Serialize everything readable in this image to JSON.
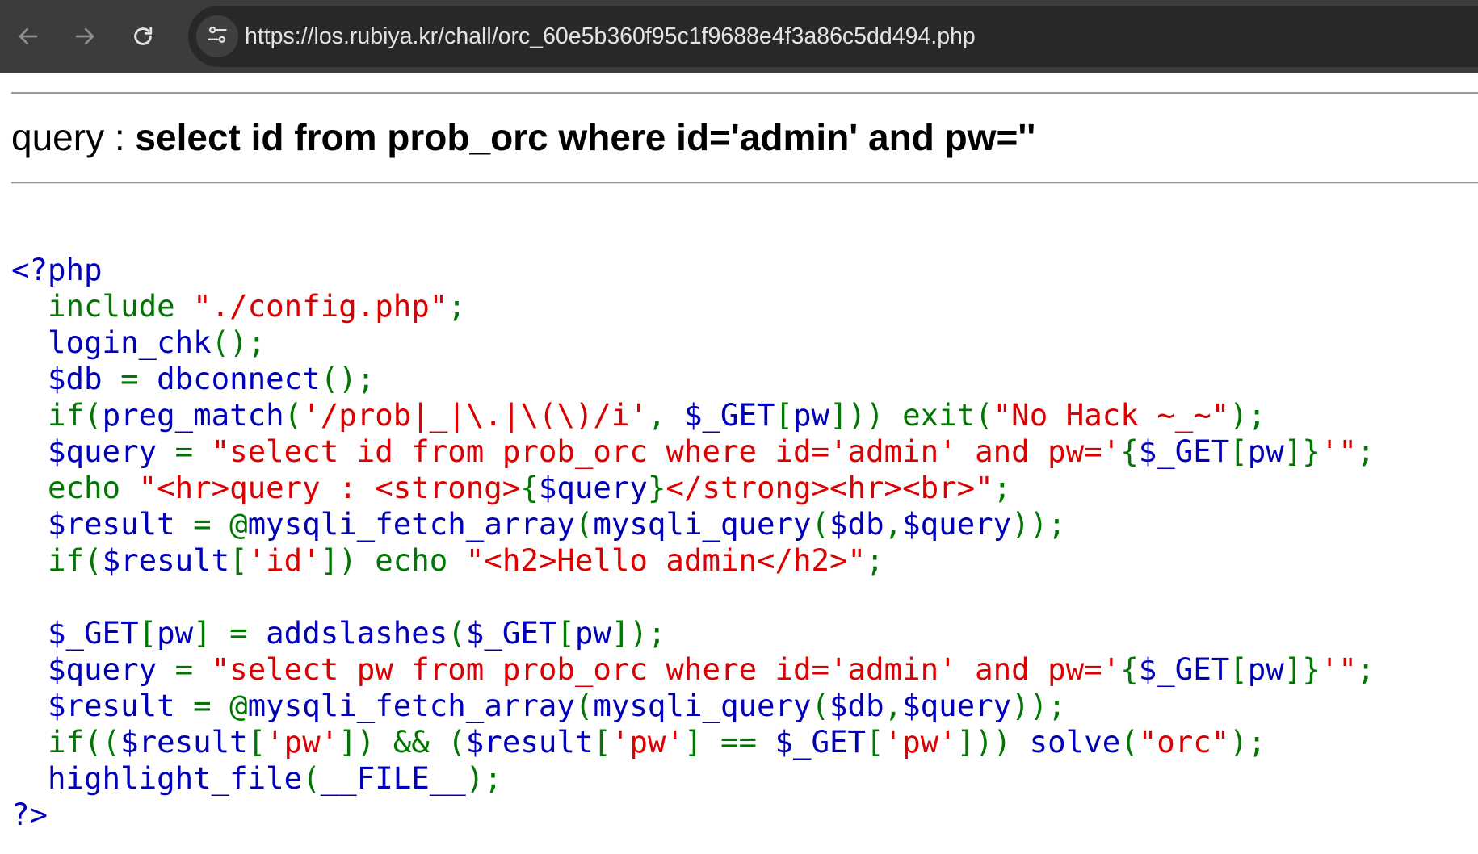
{
  "browser": {
    "url": "https://los.rubiya.kr/chall/orc_60e5b360f95c1f9688e4f3a86c5dd494.php",
    "back_icon": "arrow-left-icon",
    "forward_icon": "arrow-right-icon",
    "reload_icon": "reload-icon",
    "site_info_icon": "tune-icon",
    "colors": {
      "toolbar": "#3c3c3c",
      "omnibox": "#282828",
      "url_text": "#e3e3e3"
    }
  },
  "page": {
    "query_label": "query : ",
    "query_value": "select id from prob_orc where id='admin' and pw=''"
  },
  "code_colors": {
    "keyword": "#0000bb",
    "default": "#007700",
    "string": "#dd0000"
  },
  "code": [
    [
      [
        "k",
        "<?php"
      ]
    ],
    [
      [
        "g",
        "  include "
      ],
      [
        "r",
        "\"./config.php\""
      ],
      [
        "g",
        ";"
      ]
    ],
    [
      [
        "k",
        "  login_chk"
      ],
      [
        "g",
        "();"
      ]
    ],
    [
      [
        "k",
        "  $db "
      ],
      [
        "g",
        "= "
      ],
      [
        "k",
        "dbconnect"
      ],
      [
        "g",
        "();"
      ]
    ],
    [
      [
        "g",
        "  if("
      ],
      [
        "k",
        "preg_match"
      ],
      [
        "g",
        "("
      ],
      [
        "r",
        "'/prob|_|\\.|\\(\\)/i'"
      ],
      [
        "g",
        ", "
      ],
      [
        "k",
        "$_GET"
      ],
      [
        "g",
        "["
      ],
      [
        "k",
        "pw"
      ],
      [
        "g",
        "])) exit("
      ],
      [
        "r",
        "\"No Hack ~_~\""
      ],
      [
        "g",
        ");"
      ]
    ],
    [
      [
        "k",
        "  $query "
      ],
      [
        "g",
        "= "
      ],
      [
        "r",
        "\"select id from prob_orc where id='admin' and pw='"
      ],
      [
        "g",
        "{"
      ],
      [
        "k",
        "$_GET"
      ],
      [
        "g",
        "["
      ],
      [
        "k",
        "pw"
      ],
      [
        "g",
        "]}"
      ],
      [
        "r",
        "'\""
      ],
      [
        "g",
        ";"
      ]
    ],
    [
      [
        "g",
        "  echo "
      ],
      [
        "r",
        "\"<hr>query : <strong>"
      ],
      [
        "g",
        "{"
      ],
      [
        "k",
        "$query"
      ],
      [
        "g",
        "}"
      ],
      [
        "r",
        "</strong><hr><br>\""
      ],
      [
        "g",
        ";"
      ]
    ],
    [
      [
        "k",
        "  $result "
      ],
      [
        "g",
        "= @"
      ],
      [
        "k",
        "mysqli_fetch_array"
      ],
      [
        "g",
        "("
      ],
      [
        "k",
        "mysqli_query"
      ],
      [
        "g",
        "("
      ],
      [
        "k",
        "$db"
      ],
      [
        "g",
        ","
      ],
      [
        "k",
        "$query"
      ],
      [
        "g",
        "));"
      ]
    ],
    [
      [
        "g",
        "  if("
      ],
      [
        "k",
        "$result"
      ],
      [
        "g",
        "["
      ],
      [
        "r",
        "'id'"
      ],
      [
        "g",
        "]) echo "
      ],
      [
        "r",
        "\"<h2>Hello admin</h2>\""
      ],
      [
        "g",
        ";"
      ]
    ],
    [
      [
        "g",
        ""
      ]
    ],
    [
      [
        "k",
        "  $_GET"
      ],
      [
        "g",
        "["
      ],
      [
        "k",
        "pw"
      ],
      [
        "g",
        "] = "
      ],
      [
        "k",
        "addslashes"
      ],
      [
        "g",
        "("
      ],
      [
        "k",
        "$_GET"
      ],
      [
        "g",
        "["
      ],
      [
        "k",
        "pw"
      ],
      [
        "g",
        "]);"
      ]
    ],
    [
      [
        "k",
        "  $query "
      ],
      [
        "g",
        "= "
      ],
      [
        "r",
        "\"select pw from prob_orc where id='admin' and pw='"
      ],
      [
        "g",
        "{"
      ],
      [
        "k",
        "$_GET"
      ],
      [
        "g",
        "["
      ],
      [
        "k",
        "pw"
      ],
      [
        "g",
        "]}"
      ],
      [
        "r",
        "'\""
      ],
      [
        "g",
        ";"
      ]
    ],
    [
      [
        "k",
        "  $result "
      ],
      [
        "g",
        "= @"
      ],
      [
        "k",
        "mysqli_fetch_array"
      ],
      [
        "g",
        "("
      ],
      [
        "k",
        "mysqli_query"
      ],
      [
        "g",
        "("
      ],
      [
        "k",
        "$db"
      ],
      [
        "g",
        ","
      ],
      [
        "k",
        "$query"
      ],
      [
        "g",
        "));"
      ]
    ],
    [
      [
        "g",
        "  if(("
      ],
      [
        "k",
        "$result"
      ],
      [
        "g",
        "["
      ],
      [
        "r",
        "'pw'"
      ],
      [
        "g",
        "]) && ("
      ],
      [
        "k",
        "$result"
      ],
      [
        "g",
        "["
      ],
      [
        "r",
        "'pw'"
      ],
      [
        "g",
        "] == "
      ],
      [
        "k",
        "$_GET"
      ],
      [
        "g",
        "["
      ],
      [
        "r",
        "'pw'"
      ],
      [
        "g",
        "])) "
      ],
      [
        "k",
        "solve"
      ],
      [
        "g",
        "("
      ],
      [
        "r",
        "\"orc\""
      ],
      [
        "g",
        ");"
      ]
    ],
    [
      [
        "k",
        "  highlight_file"
      ],
      [
        "g",
        "("
      ],
      [
        "k",
        "__FILE__"
      ],
      [
        "g",
        ");"
      ]
    ],
    [
      [
        "k",
        "?>"
      ]
    ]
  ]
}
